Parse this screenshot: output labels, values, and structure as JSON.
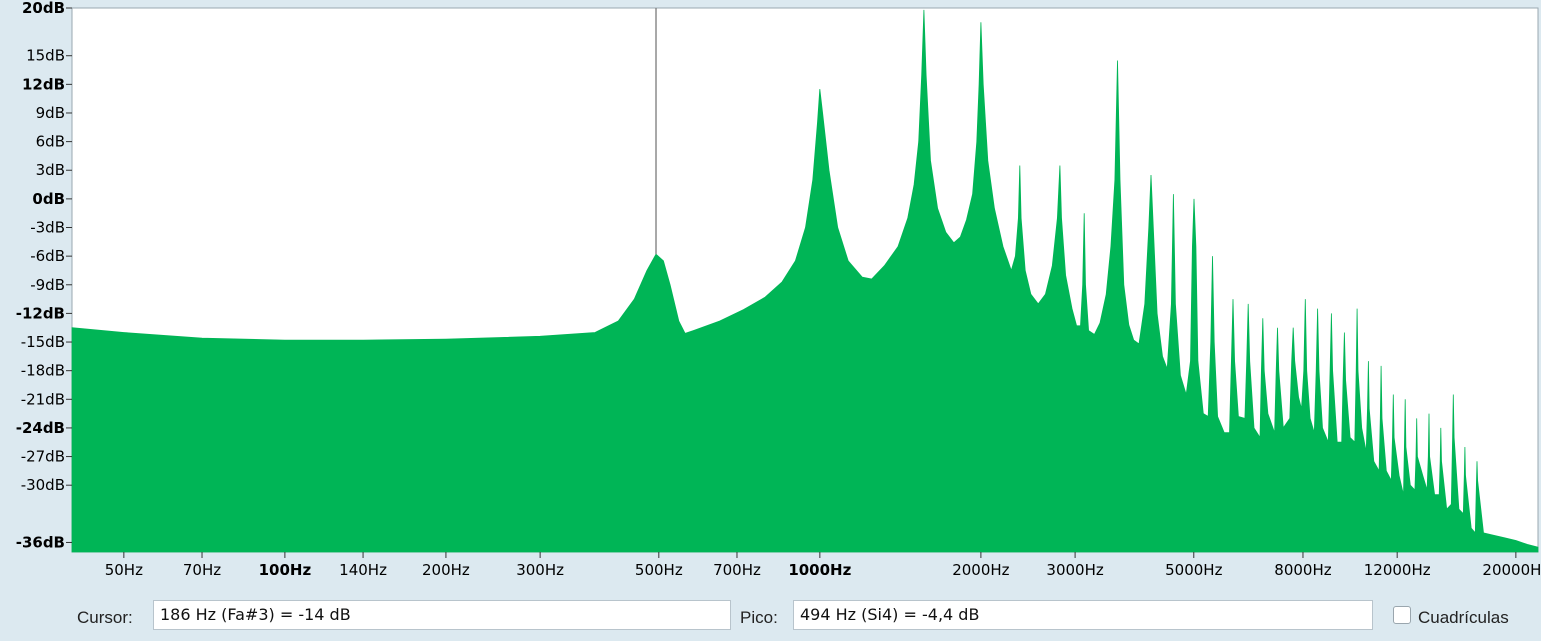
{
  "chart_data": {
    "type": "area",
    "xscale": "log",
    "xlim": [
      40,
      22000
    ],
    "ylim": [
      -37,
      20
    ],
    "grid": false,
    "color": "#00b556",
    "y_ticks": [
      {
        "value": 20,
        "label": "20dB",
        "bold": true
      },
      {
        "value": 15,
        "label": "15dB",
        "bold": false
      },
      {
        "value": 12,
        "label": "12dB",
        "bold": true
      },
      {
        "value": 9,
        "label": "9dB",
        "bold": false
      },
      {
        "value": 6,
        "label": "6dB",
        "bold": false
      },
      {
        "value": 3,
        "label": "3dB",
        "bold": false
      },
      {
        "value": 0,
        "label": "0dB",
        "bold": true
      },
      {
        "value": -3,
        "label": "-3dB",
        "bold": false
      },
      {
        "value": -6,
        "label": "-6dB",
        "bold": false
      },
      {
        "value": -9,
        "label": "-9dB",
        "bold": false
      },
      {
        "value": -12,
        "label": "-12dB",
        "bold": true
      },
      {
        "value": -15,
        "label": "-15dB",
        "bold": false
      },
      {
        "value": -18,
        "label": "-18dB",
        "bold": false
      },
      {
        "value": -21,
        "label": "-21dB",
        "bold": false
      },
      {
        "value": -24,
        "label": "-24dB",
        "bold": true
      },
      {
        "value": -27,
        "label": "-27dB",
        "bold": false
      },
      {
        "value": -30,
        "label": "-30dB",
        "bold": false
      },
      {
        "value": -36,
        "label": "-36dB",
        "bold": true
      }
    ],
    "x_ticks": [
      {
        "value": 50,
        "label": "50Hz",
        "bold": false
      },
      {
        "value": 70,
        "label": "70Hz",
        "bold": false
      },
      {
        "value": 100,
        "label": "100Hz",
        "bold": true
      },
      {
        "value": 140,
        "label": "140Hz",
        "bold": false
      },
      {
        "value": 200,
        "label": "200Hz",
        "bold": false
      },
      {
        "value": 300,
        "label": "300Hz",
        "bold": false
      },
      {
        "value": 500,
        "label": "500Hz",
        "bold": false
      },
      {
        "value": 700,
        "label": "700Hz",
        "bold": false
      },
      {
        "value": 1000,
        "label": "1000Hz",
        "bold": true
      },
      {
        "value": 2000,
        "label": "2000Hz",
        "bold": false
      },
      {
        "value": 3000,
        "label": "3000Hz",
        "bold": false
      },
      {
        "value": 5000,
        "label": "5000Hz",
        "bold": false
      },
      {
        "value": 8000,
        "label": "8000Hz",
        "bold": false
      },
      {
        "value": 12000,
        "label": "12000Hz",
        "bold": false
      },
      {
        "value": 20000,
        "label": "20000Hz",
        "bold": false
      }
    ],
    "cursor_hz": 494,
    "spectrum": [
      [
        40,
        -13.5
      ],
      [
        50,
        -14
      ],
      [
        70,
        -14.6
      ],
      [
        100,
        -14.8
      ],
      [
        140,
        -14.8
      ],
      [
        200,
        -14.7
      ],
      [
        300,
        -14.4
      ],
      [
        380,
        -14
      ],
      [
        420,
        -12.8
      ],
      [
        450,
        -10.5
      ],
      [
        475,
        -7.5
      ],
      [
        494,
        -5.8
      ],
      [
        510,
        -6.5
      ],
      [
        525,
        -9
      ],
      [
        545,
        -12.8
      ],
      [
        560,
        -14.1
      ],
      [
        580,
        -13.8
      ],
      [
        650,
        -12.8
      ],
      [
        720,
        -11.6
      ],
      [
        790,
        -10.3
      ],
      [
        850,
        -8.7
      ],
      [
        900,
        -6.5
      ],
      [
        940,
        -3
      ],
      [
        970,
        2
      ],
      [
        990,
        8
      ],
      [
        1000,
        11.5
      ],
      [
        1012,
        9
      ],
      [
        1040,
        3
      ],
      [
        1080,
        -3
      ],
      [
        1130,
        -6.5
      ],
      [
        1200,
        -8.2
      ],
      [
        1250,
        -8.4
      ],
      [
        1320,
        -7
      ],
      [
        1400,
        -5
      ],
      [
        1460,
        -2
      ],
      [
        1500,
        1.5
      ],
      [
        1530,
        6
      ],
      [
        1550,
        13
      ],
      [
        1565,
        19.8
      ],
      [
        1580,
        13
      ],
      [
        1610,
        4
      ],
      [
        1660,
        -1
      ],
      [
        1720,
        -3.5
      ],
      [
        1780,
        -4.6
      ],
      [
        1830,
        -4
      ],
      [
        1880,
        -2.2
      ],
      [
        1930,
        0.5
      ],
      [
        1965,
        6
      ],
      [
        1985,
        12
      ],
      [
        2000,
        18.5
      ],
      [
        2020,
        12
      ],
      [
        2060,
        4
      ],
      [
        2120,
        -1
      ],
      [
        2200,
        -5
      ],
      [
        2280,
        -7.5
      ],
      [
        2320,
        -6
      ],
      [
        2350,
        -2
      ],
      [
        2365,
        3.5
      ],
      [
        2378,
        -2
      ],
      [
        2420,
        -7.5
      ],
      [
        2480,
        -10
      ],
      [
        2560,
        -11
      ],
      [
        2640,
        -10
      ],
      [
        2720,
        -7
      ],
      [
        2780,
        -2
      ],
      [
        2810,
        3.5
      ],
      [
        2830,
        -2
      ],
      [
        2880,
        -8
      ],
      [
        2960,
        -11.5
      ],
      [
        3020,
        -13.3
      ],
      [
        3070,
        -13.3
      ],
      [
        3100,
        -9
      ],
      [
        3120,
        -1.5
      ],
      [
        3138,
        -9
      ],
      [
        3180,
        -13.8
      ],
      [
        3260,
        -14.2
      ],
      [
        3340,
        -13
      ],
      [
        3430,
        -10
      ],
      [
        3500,
        -5
      ],
      [
        3560,
        2
      ],
      [
        3600,
        14.5
      ],
      [
        3640,
        2
      ],
      [
        3700,
        -9
      ],
      [
        3780,
        -13.2
      ],
      [
        3860,
        -14.8
      ],
      [
        3950,
        -15.2
      ],
      [
        4050,
        -11
      ],
      [
        4120,
        -3
      ],
      [
        4160,
        2.5
      ],
      [
        4200,
        -3
      ],
      [
        4270,
        -12
      ],
      [
        4370,
        -16.5
      ],
      [
        4460,
        -17.8
      ],
      [
        4540,
        -11
      ],
      [
        4580,
        0.5
      ],
      [
        4620,
        -11
      ],
      [
        4720,
        -18.5
      ],
      [
        4840,
        -20.5
      ],
      [
        4930,
        -17
      ],
      [
        4970,
        -5
      ],
      [
        5005,
        0
      ],
      [
        5045,
        -5
      ],
      [
        5090,
        -17
      ],
      [
        5210,
        -22.5
      ],
      [
        5320,
        -22.8
      ],
      [
        5380,
        -15
      ],
      [
        5420,
        -6
      ],
      [
        5460,
        -15
      ],
      [
        5540,
        -22.8
      ],
      [
        5700,
        -24.5
      ],
      [
        5830,
        -24.5
      ],
      [
        5880,
        -17
      ],
      [
        5920,
        -10.5
      ],
      [
        5960,
        -17
      ],
      [
        6060,
        -22.8
      ],
      [
        6230,
        -23
      ],
      [
        6280,
        -17
      ],
      [
        6320,
        -11
      ],
      [
        6360,
        -17
      ],
      [
        6480,
        -24
      ],
      [
        6650,
        -25
      ],
      [
        6690,
        -18
      ],
      [
        6730,
        -12.5
      ],
      [
        6770,
        -18
      ],
      [
        6880,
        -22.5
      ],
      [
        7080,
        -24.5
      ],
      [
        7130,
        -18
      ],
      [
        7170,
        -13.5
      ],
      [
        7210,
        -18
      ],
      [
        7350,
        -24
      ],
      [
        7560,
        -23
      ],
      [
        7620,
        -17
      ],
      [
        7670,
        -13.5
      ],
      [
        7720,
        -17
      ],
      [
        7850,
        -20.8
      ],
      [
        7950,
        -22
      ],
      [
        8030,
        -18
      ],
      [
        8080,
        -10.5
      ],
      [
        8130,
        -18
      ],
      [
        8250,
        -23
      ],
      [
        8400,
        -24.5
      ],
      [
        8470,
        -18
      ],
      [
        8520,
        -11.5
      ],
      [
        8570,
        -18
      ],
      [
        8700,
        -24
      ],
      [
        8920,
        -25.5
      ],
      [
        8990,
        -18
      ],
      [
        9040,
        -12
      ],
      [
        9090,
        -18
      ],
      [
        9270,
        -25.5
      ],
      [
        9450,
        -25.5
      ],
      [
        9510,
        -19
      ],
      [
        9560,
        -14
      ],
      [
        9610,
        -19
      ],
      [
        9800,
        -25
      ],
      [
        10000,
        -25.5
      ],
      [
        10060,
        -18
      ],
      [
        10100,
        -11.5
      ],
      [
        10140,
        -18
      ],
      [
        10300,
        -24
      ],
      [
        10500,
        -26.5
      ],
      [
        10560,
        -22
      ],
      [
        10600,
        -17
      ],
      [
        10640,
        -22
      ],
      [
        10850,
        -27.5
      ],
      [
        11100,
        -28.5
      ],
      [
        11160,
        -23
      ],
      [
        11200,
        -17.5
      ],
      [
        11240,
        -23
      ],
      [
        11450,
        -28.5
      ],
      [
        11700,
        -29.5
      ],
      [
        11760,
        -25
      ],
      [
        11800,
        -20.5
      ],
      [
        11840,
        -25
      ],
      [
        12100,
        -29
      ],
      [
        12330,
        -31
      ],
      [
        12380,
        -26
      ],
      [
        12420,
        -21
      ],
      [
        12460,
        -26
      ],
      [
        12700,
        -30
      ],
      [
        12950,
        -30.5
      ],
      [
        13010,
        -27
      ],
      [
        13050,
        -23
      ],
      [
        13090,
        -27
      ],
      [
        13400,
        -29
      ],
      [
        13650,
        -30.5
      ],
      [
        13720,
        -27
      ],
      [
        13760,
        -22.5
      ],
      [
        13800,
        -27
      ],
      [
        14100,
        -31
      ],
      [
        14380,
        -31
      ],
      [
        14440,
        -27.5
      ],
      [
        14480,
        -24
      ],
      [
        14520,
        -27.5
      ],
      [
        14850,
        -32.5
      ],
      [
        15150,
        -32
      ],
      [
        15230,
        -25
      ],
      [
        15280,
        -20.5
      ],
      [
        15330,
        -25
      ],
      [
        15650,
        -32.5
      ],
      [
        15950,
        -33
      ],
      [
        16020,
        -29
      ],
      [
        16060,
        -26
      ],
      [
        16100,
        -29
      ],
      [
        16500,
        -34.5
      ],
      [
        16800,
        -35
      ],
      [
        16880,
        -29.5
      ],
      [
        16920,
        -27.5
      ],
      [
        16960,
        -29.5
      ],
      [
        17400,
        -35
      ],
      [
        18000,
        -35.2
      ],
      [
        19000,
        -35.5
      ],
      [
        20000,
        -35.8
      ],
      [
        21000,
        -36.2
      ],
      [
        22000,
        -36.5
      ]
    ]
  },
  "footer": {
    "cursor_label": "Cursor:",
    "cursor_value": "186 Hz (Fa#3) = -14 dB",
    "peak_label": "Pico:",
    "peak_value": "494 Hz (Si4) = -4,4 dB",
    "grid_label": "Cuadrículas",
    "grid_checked": false
  }
}
